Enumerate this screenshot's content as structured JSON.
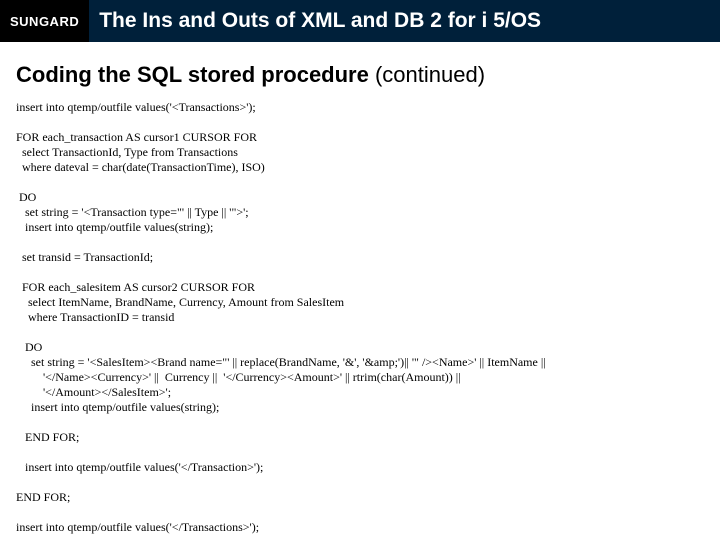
{
  "logo": "SUNGARD",
  "title": "The Ins and Outs of XML and DB 2 for i 5/OS",
  "heading_bold": "Coding the SQL stored procedure",
  "heading_cont": " (continued)",
  "code": "insert into qtemp/outfile values('<Transactions>');\n\nFOR each_transaction AS cursor1 CURSOR FOR\n  select TransactionId, Type from Transactions\n  where dateval = char(date(TransactionTime), ISO)\n\n DO\n   set string = '<Transaction type=\"' || Type || '\">';\n   insert into qtemp/outfile values(string);\n\n  set transid = TransactionId;\n\n  FOR each_salesitem AS cursor2 CURSOR FOR\n    select ItemName, BrandName, Currency, Amount from SalesItem\n    where TransactionID = transid\n\n   DO\n     set string = '<SalesItem><Brand name=\"' || replace(BrandName, '&', '&amp;')|| '\" /><Name>' || ItemName ||\n         '</Name><Currency>' ||  Currency ||  '</Currency><Amount>' || rtrim(char(Amount)) ||\n         '</Amount></SalesItem>';\n     insert into qtemp/outfile values(string);\n\n   END FOR;\n\n   insert into qtemp/outfile values('</Transaction>');\n\nEND FOR;\n\ninsert into qtemp/outfile values('</Transactions>');"
}
